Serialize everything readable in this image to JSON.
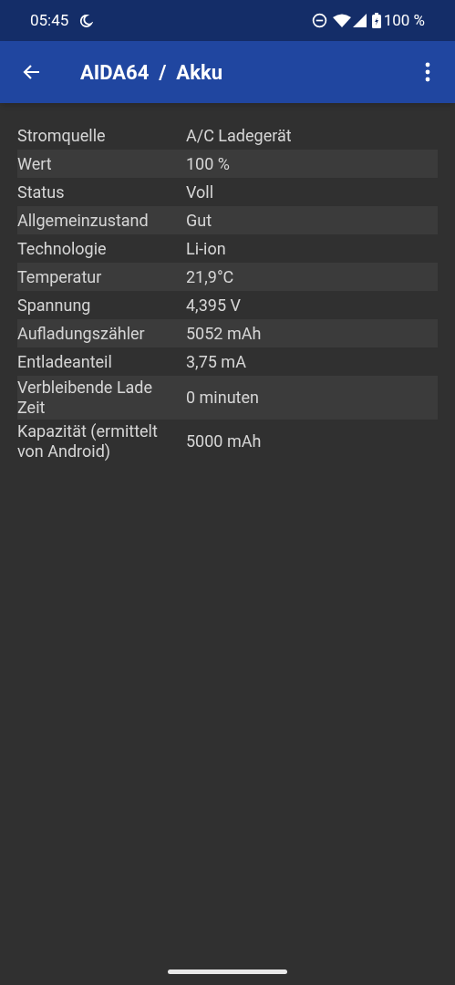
{
  "status_bar": {
    "time": "05:45",
    "battery": "100 %"
  },
  "app_bar": {
    "title": "AIDA64  /  Akku"
  },
  "rows": [
    {
      "label": "Stromquelle",
      "value": "A/C Ladegerät"
    },
    {
      "label": "Wert",
      "value": "100 %"
    },
    {
      "label": "Status",
      "value": "Voll"
    },
    {
      "label": "Allgemeinzustand",
      "value": "Gut"
    },
    {
      "label": "Technologie",
      "value": "Li-ion"
    },
    {
      "label": "Temperatur",
      "value": "21,9°C"
    },
    {
      "label": "Spannung",
      "value": "4,395 V"
    },
    {
      "label": "Aufladungszähler",
      "value": "5052 mAh"
    },
    {
      "label": "Entladeanteil",
      "value": "3,75 mA"
    },
    {
      "label": "Verbleibende Lade Zeit",
      "value": "0 minuten"
    },
    {
      "label": "Kapazität (ermittelt von Android)",
      "value": "5000 mAh"
    }
  ]
}
